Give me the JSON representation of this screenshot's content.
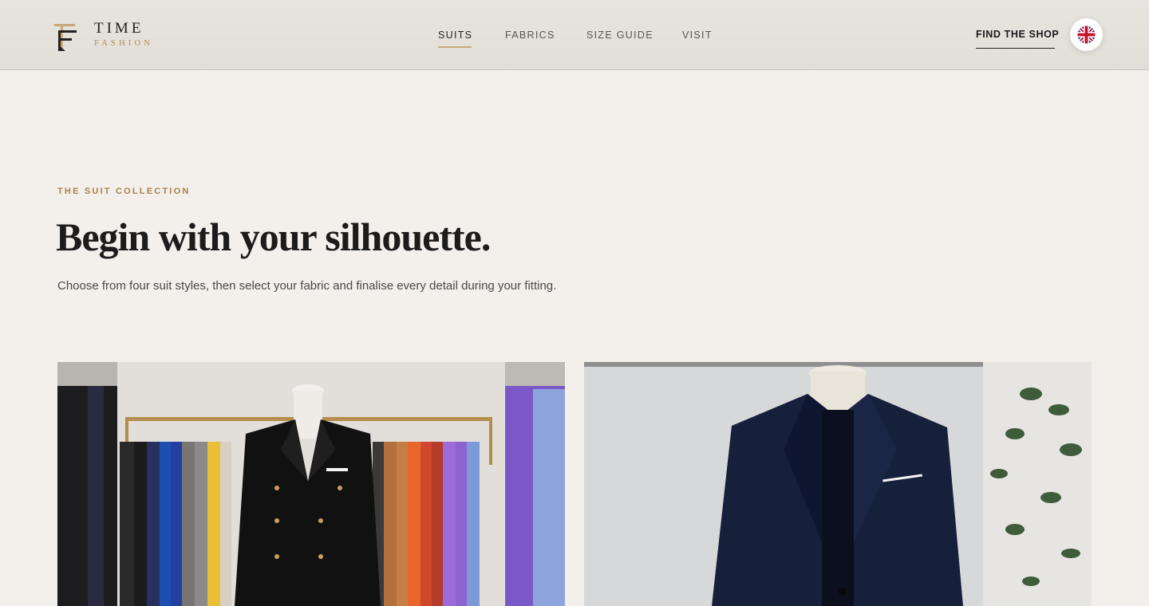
{
  "brand": {
    "name": "TIME",
    "tagline": "FASHION",
    "accent_color": "#c8a878",
    "gold_text_color": "#a7804a"
  },
  "nav": {
    "items": [
      {
        "label": "SUITS",
        "active": true
      },
      {
        "label": "FABRICS",
        "active": false
      },
      {
        "label": "SIZE GUIDE",
        "active": false
      },
      {
        "label": "VISIT",
        "active": false
      }
    ],
    "find_shop": "FIND THE SHOP",
    "language_icon": "uk-flag-icon"
  },
  "intro": {
    "eyebrow": "THE SUIT COLLECTION",
    "headline": "Begin with your silhouette.",
    "description": "Choose from four suit styles, then select your fabric and finalise every detail during your fitting."
  },
  "cards": [
    {
      "image": "double-breasted-black-suit-on-mannequin-with-colorful-jacket-rack"
    },
    {
      "image": "navy-single-breasted-suit-on-mannequin-with-plant"
    }
  ]
}
